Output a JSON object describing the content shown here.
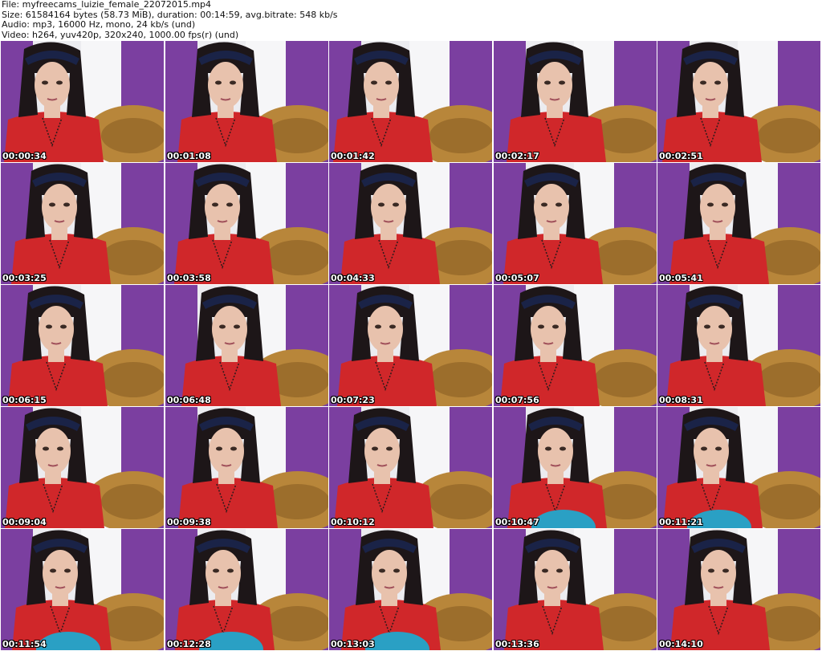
{
  "header": {
    "file": "File: myfreecams_luizie_female_22072015.mp4",
    "size": "Size: 61584164 bytes (58.73 MiB), duration: 00:14:59, avg.bitrate: 548 kb/s",
    "audio": "Audio: mp3, 16000 Hz, mono, 24 kb/s (und)",
    "video": "Video: h264, yuv420p, 320x240, 1000.00 fps(r) (und)"
  },
  "colors": {
    "curtain": "#7b3fa0",
    "wall": "#ececf0",
    "shirt": "#d0272a",
    "chair": "#b8863a",
    "hair": "#1d1618",
    "skin": "#e8c2ad",
    "teal": "#2aa0c4"
  },
  "thumbnails": [
    {
      "time": "00:00:34"
    },
    {
      "time": "00:01:08"
    },
    {
      "time": "00:01:42"
    },
    {
      "time": "00:02:17"
    },
    {
      "time": "00:02:51"
    },
    {
      "time": "00:03:25"
    },
    {
      "time": "00:03:58"
    },
    {
      "time": "00:04:33"
    },
    {
      "time": "00:05:07"
    },
    {
      "time": "00:05:41"
    },
    {
      "time": "00:06:15"
    },
    {
      "time": "00:06:48"
    },
    {
      "time": "00:07:23"
    },
    {
      "time": "00:07:56"
    },
    {
      "time": "00:08:31"
    },
    {
      "time": "00:09:04"
    },
    {
      "time": "00:09:38"
    },
    {
      "time": "00:10:12"
    },
    {
      "time": "00:10:47",
      "teal": true
    },
    {
      "time": "00:11:21",
      "teal": true
    },
    {
      "time": "00:11:54",
      "teal": true
    },
    {
      "time": "00:12:28",
      "teal": true
    },
    {
      "time": "00:13:03",
      "teal": true
    },
    {
      "time": "00:13:36"
    },
    {
      "time": "00:14:10"
    }
  ]
}
